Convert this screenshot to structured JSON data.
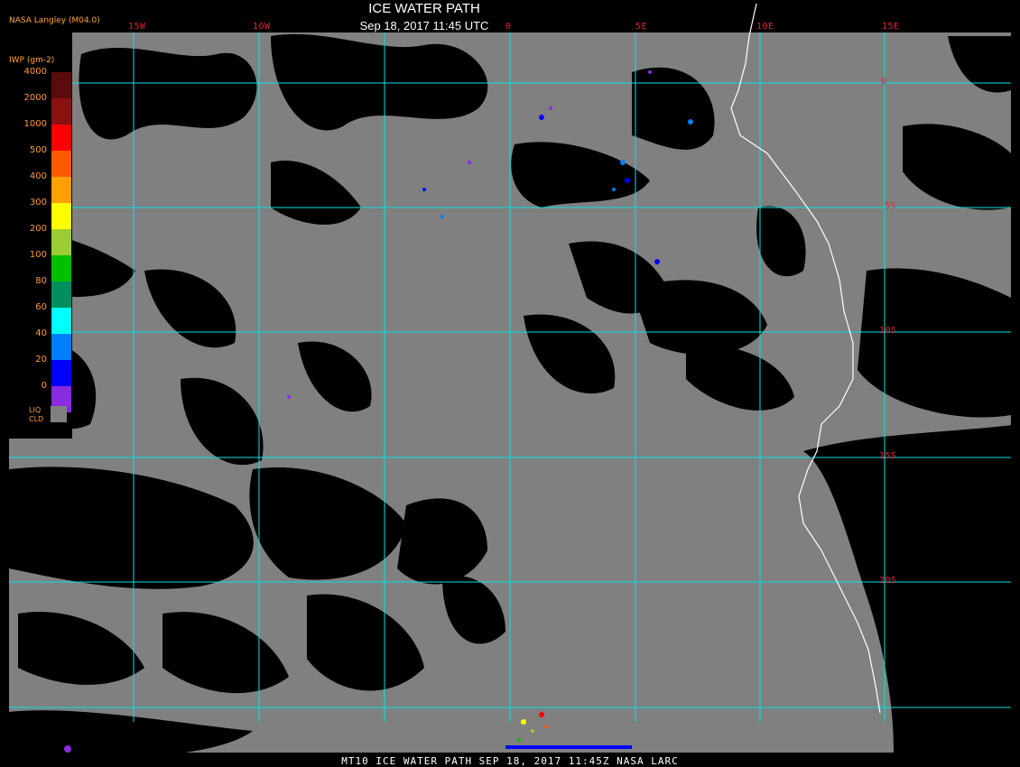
{
  "header": {
    "title": "ICE WATER PATH",
    "datetime": "Sep 18, 2017 11:45 UTC",
    "credit": "NASA Langley (M04.0)"
  },
  "lon_labels": [
    "15W",
    "10W",
    "0",
    "5E",
    "10E",
    "15E"
  ],
  "lat_labels": [
    "0",
    "5S",
    "10S",
    "15S",
    "20S"
  ],
  "legend": {
    "unit": "IWP (gm-2)",
    "liquid_label_1": "LIQ",
    "liquid_label_2": "CLD",
    "liquid_color": "#808080",
    "entries": [
      {
        "value": "4000",
        "color": "#5a0b0b"
      },
      {
        "value": "2000",
        "color": "#8b1010"
      },
      {
        "value": "1000",
        "color": "#ff0000"
      },
      {
        "value": "500",
        "color": "#ff5a00"
      },
      {
        "value": "400",
        "color": "#ff9f00"
      },
      {
        "value": "300",
        "color": "#ffff00"
      },
      {
        "value": "200",
        "color": "#9acd32"
      },
      {
        "value": "100",
        "color": "#00c000"
      },
      {
        "value": "80",
        "color": "#009060"
      },
      {
        "value": "60",
        "color": "#00ffff"
      },
      {
        "value": "40",
        "color": "#0080ff"
      },
      {
        "value": "20",
        "color": "#0000ff"
      },
      {
        "value": "0",
        "color": "#8a2be2"
      }
    ]
  },
  "colors": {
    "grid": "#00e5e5",
    "land": "#808080",
    "coast": "#ffffff",
    "label": "#e0253a"
  },
  "footer": "MT10  ICE WATER PATH  SEP 18, 2017 11:45Z  NASA LARC"
}
